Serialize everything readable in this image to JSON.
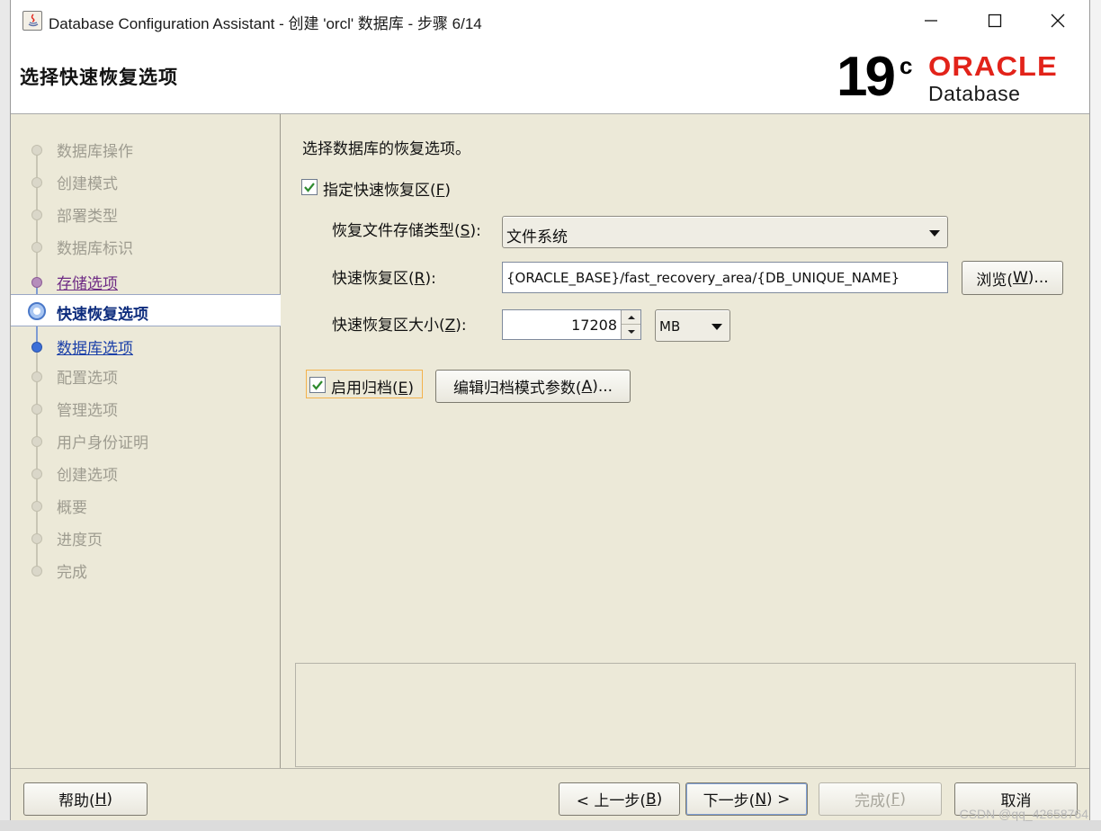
{
  "window": {
    "title": "Database Configuration Assistant - 创建 'orcl' 数据库 - 步骤 6/14"
  },
  "header": {
    "step_title": "选择快速恢复选项",
    "logo_version": "19",
    "logo_sup": "c",
    "logo_brand": "ORACLE",
    "logo_product": "Database"
  },
  "nav": {
    "items": [
      {
        "label": "数据库操作",
        "state": "disabled"
      },
      {
        "label": "创建模式",
        "state": "disabled"
      },
      {
        "label": "部署类型",
        "state": "disabled"
      },
      {
        "label": "数据库标识",
        "state": "disabled"
      },
      {
        "label": "存储选项",
        "state": "visited"
      },
      {
        "label": "快速恢复选项",
        "state": "current"
      },
      {
        "label": "数据库选项",
        "state": "link"
      },
      {
        "label": "配置选项",
        "state": "disabled"
      },
      {
        "label": "管理选项",
        "state": "disabled"
      },
      {
        "label": "用户身份证明",
        "state": "disabled"
      },
      {
        "label": "创建选项",
        "state": "disabled"
      },
      {
        "label": "概要",
        "state": "disabled"
      },
      {
        "label": "进度页",
        "state": "disabled"
      },
      {
        "label": "完成",
        "state": "disabled"
      }
    ]
  },
  "content": {
    "intro": "选择数据库的恢复选项。",
    "fra_checkbox": {
      "label": "指定快速恢复区(",
      "mnemonic": "F",
      "label_end": ")",
      "checked": true
    },
    "storage_type": {
      "label": "恢复文件存储类型(",
      "mnemonic": "S",
      "label_end": "):",
      "value": "文件系统"
    },
    "fra_location": {
      "label": "快速恢复区(",
      "mnemonic": "R",
      "label_end": "):",
      "value": "{ORACLE_BASE}/fast_recovery_area/{DB_UNIQUE_NAME}"
    },
    "browse_button": {
      "label": "浏览(",
      "mnemonic": "W",
      "label_end": ")..."
    },
    "fra_size": {
      "label": "快速恢复区大小(",
      "mnemonic": "Z",
      "label_end": "):",
      "value": "17208",
      "unit": "MB"
    },
    "archive_checkbox": {
      "label": "启用归档(",
      "mnemonic": "E",
      "label_end": ")",
      "checked": true
    },
    "archive_params_button": {
      "label": "编辑归档模式参数(",
      "mnemonic": "A",
      "label_end": ")..."
    }
  },
  "footer": {
    "help": {
      "label": "帮助(",
      "mnemonic": "H",
      "label_end": ")"
    },
    "back": {
      "label": "< 上一步(",
      "mnemonic": "B",
      "label_end": ")"
    },
    "next": {
      "label": "下一步(",
      "mnemonic": "N",
      "label_end": ") >"
    },
    "finish": {
      "label": "完成(",
      "mnemonic": "F",
      "label_end": ")",
      "enabled": false
    },
    "cancel": {
      "label": "取消"
    }
  },
  "watermark": "CSDN @qq_42658764"
}
